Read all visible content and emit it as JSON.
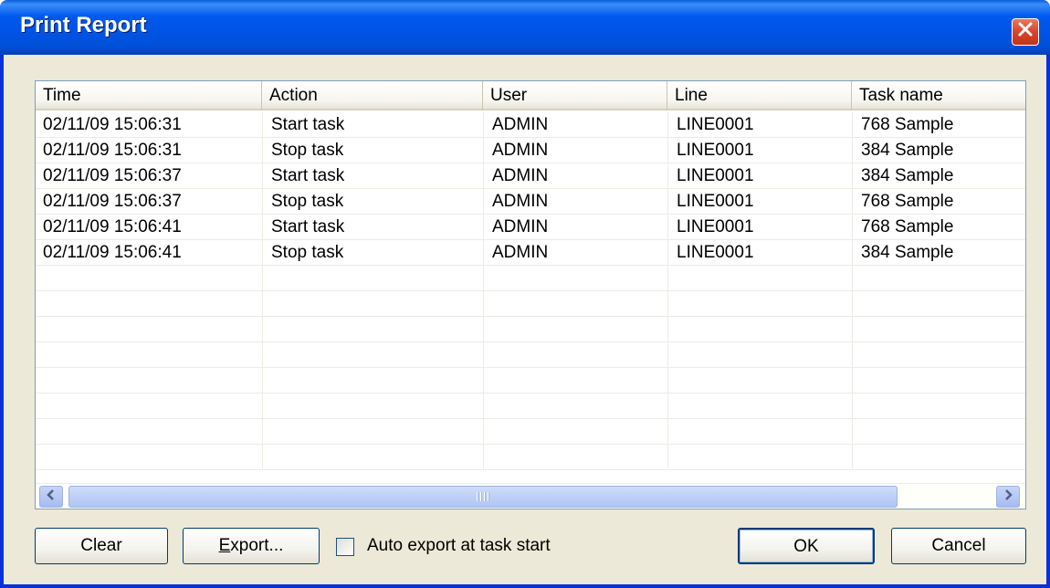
{
  "window": {
    "title": "Print Report"
  },
  "list": {
    "columns": [
      "Time",
      "Action",
      "User",
      "Line",
      "Task name"
    ],
    "rows": [
      [
        "02/11/09 15:06:31",
        "Start task",
        "ADMIN",
        "LINE0001",
        "768 Sample"
      ],
      [
        "02/11/09 15:06:31",
        "Stop task",
        "ADMIN",
        "LINE0001",
        "384 Sample"
      ],
      [
        "02/11/09 15:06:37",
        "Start task",
        "ADMIN",
        "LINE0001",
        "384 Sample"
      ],
      [
        "02/11/09 15:06:37",
        "Stop task",
        "ADMIN",
        "LINE0001",
        "768 Sample"
      ],
      [
        "02/11/09 15:06:41",
        "Start task",
        "ADMIN",
        "LINE0001",
        "768 Sample"
      ],
      [
        "02/11/09 15:06:41",
        "Stop task",
        "ADMIN",
        "LINE0001",
        "384 Sample"
      ]
    ]
  },
  "buttons": {
    "clear": "Clear",
    "export_mnemonic": "E",
    "export_rest": "xport...",
    "ok": "OK",
    "cancel": "Cancel"
  },
  "auto_export": {
    "label": "Auto export at task start",
    "checked": false
  },
  "icons": {
    "close": "close-icon",
    "scroll_left": "arrow-left-icon",
    "scroll_right": "arrow-right-icon",
    "scroll_grip": "grip-icon"
  },
  "colors": {
    "titlebar": "#0054e3",
    "client": "#ece9d8",
    "close": "#d6452b"
  }
}
